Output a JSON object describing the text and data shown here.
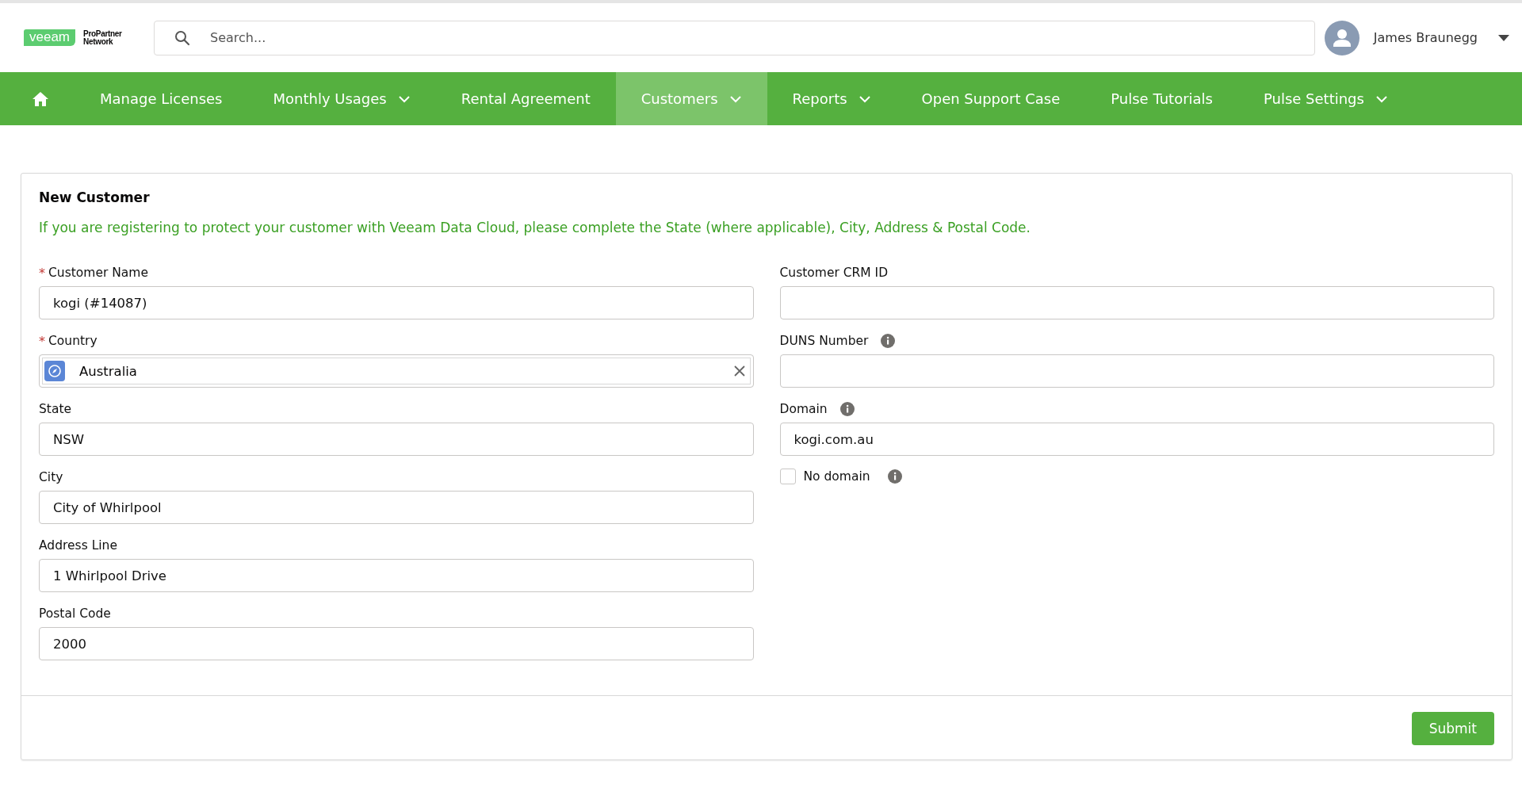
{
  "header": {
    "logo": {
      "brand": "veeam",
      "tagline_1": "ProPartner",
      "tagline_2": "Network"
    },
    "search": {
      "placeholder": "Search..."
    },
    "user": {
      "name": "James Braunegg"
    }
  },
  "nav": [
    {
      "label": "Manage Licenses",
      "selected": false
    },
    {
      "label": "Monthly Usages",
      "dropdown": true,
      "selected": false
    },
    {
      "label": "Rental Agreement",
      "selected": false
    },
    {
      "label": "Customers",
      "dropdown": true,
      "selected": true
    },
    {
      "label": "Reports",
      "dropdown": true,
      "selected": false
    },
    {
      "label": "Open Support Case",
      "selected": false
    },
    {
      "label": "Pulse Tutorials",
      "selected": false
    },
    {
      "label": "Pulse Settings",
      "dropdown": true,
      "selected": false
    }
  ],
  "form": {
    "title": "New Customer",
    "notice": "If you are registering to protect your customer with Veeam Data Cloud, please complete the State (where applicable), City, Address & Postal Code.",
    "left_fields": [
      {
        "kind": "text",
        "label": "Customer Name",
        "required_mark": "*",
        "value": "kogi (#14087)"
      },
      {
        "kind": "lookup",
        "label": "Country",
        "required_mark": "*",
        "value": "Australia"
      },
      {
        "kind": "text",
        "label": "State",
        "value": "NSW"
      },
      {
        "kind": "text",
        "label": "City",
        "value": "City of Whirlpool"
      },
      {
        "kind": "text",
        "label": "Address Line",
        "value": "1 Whirlpool Drive"
      },
      {
        "kind": "text",
        "label": "Postal Code",
        "value": "2000"
      }
    ],
    "right_fields": [
      {
        "kind": "text",
        "label": "Customer CRM ID"
      },
      {
        "kind": "text",
        "label": "DUNS Number",
        "info": true
      },
      {
        "kind": "text",
        "label": "Domain",
        "info": true,
        "value": "kogi.com.au"
      },
      {
        "kind": "checkbox",
        "label": "No domain",
        "info": true,
        "checked": false
      }
    ],
    "submit": "Submit"
  }
}
